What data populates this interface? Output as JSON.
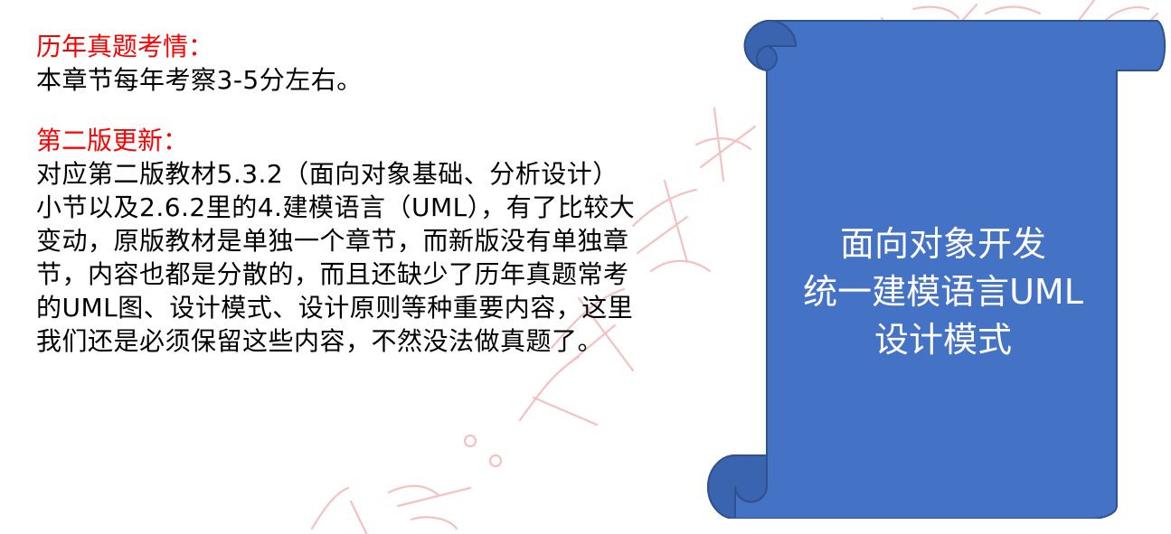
{
  "left": {
    "section1_heading": "历年真题考情：",
    "section1_body": "本章节每年考察3-5分左右。",
    "section2_heading": "第二版更新：",
    "section2_body": "对应第二版教材5.3.2（面向对象基础、分析设计）小节以及2.6.2里的4.建模语言（UML），有了比较大变动，原版教材是单独一个章节，而新版没有单独章节，内容也都是分散的，而且还缺少了历年真题常考的UML图、设计模式、设计原则等种重要内容，这里我们还是必须保留这些内容，不然没法做真题了。"
  },
  "scroll": {
    "line1": "面向对象开发",
    "line2": "统一建模语言UML",
    "line3": "设计模式"
  },
  "colors": {
    "heading": "#ff0000",
    "scroll_fill": "#4472c4",
    "scroll_stroke": "#2f528f",
    "watermark": "#f4b6b6"
  }
}
